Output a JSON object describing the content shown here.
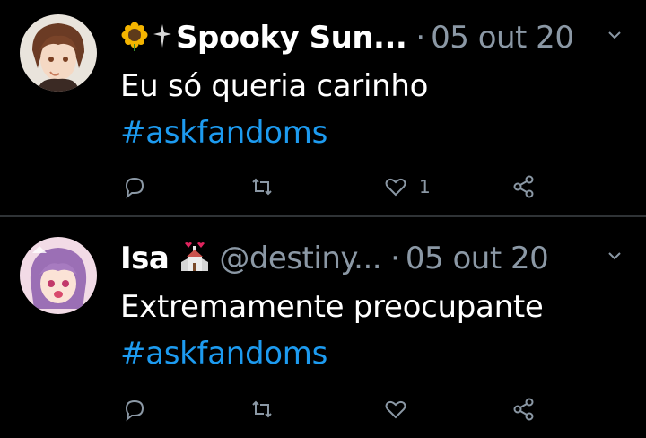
{
  "tweets": [
    {
      "name": "Spooky Sun...",
      "handle": "",
      "separator": "·",
      "date": "05 out 20",
      "text": "Eu só queria carinho",
      "hashtag": "#askfandoms",
      "likes": "1"
    },
    {
      "name": "Isa",
      "handle": "@destiny...",
      "separator": "·",
      "date": "05 out 20",
      "text": "Extremamente preocupante",
      "hashtag": "#askfandoms",
      "likes": ""
    }
  ],
  "icons": {
    "reply": "reply-icon",
    "retweet": "retweet-icon",
    "like": "heart-icon",
    "share": "share-icon",
    "more": "chevron-down-icon"
  },
  "colors": {
    "background": "#000000",
    "text": "#ffffff",
    "muted": "#8b98a5",
    "hashtag": "#1d9bf0",
    "divider": "#2f3336"
  }
}
